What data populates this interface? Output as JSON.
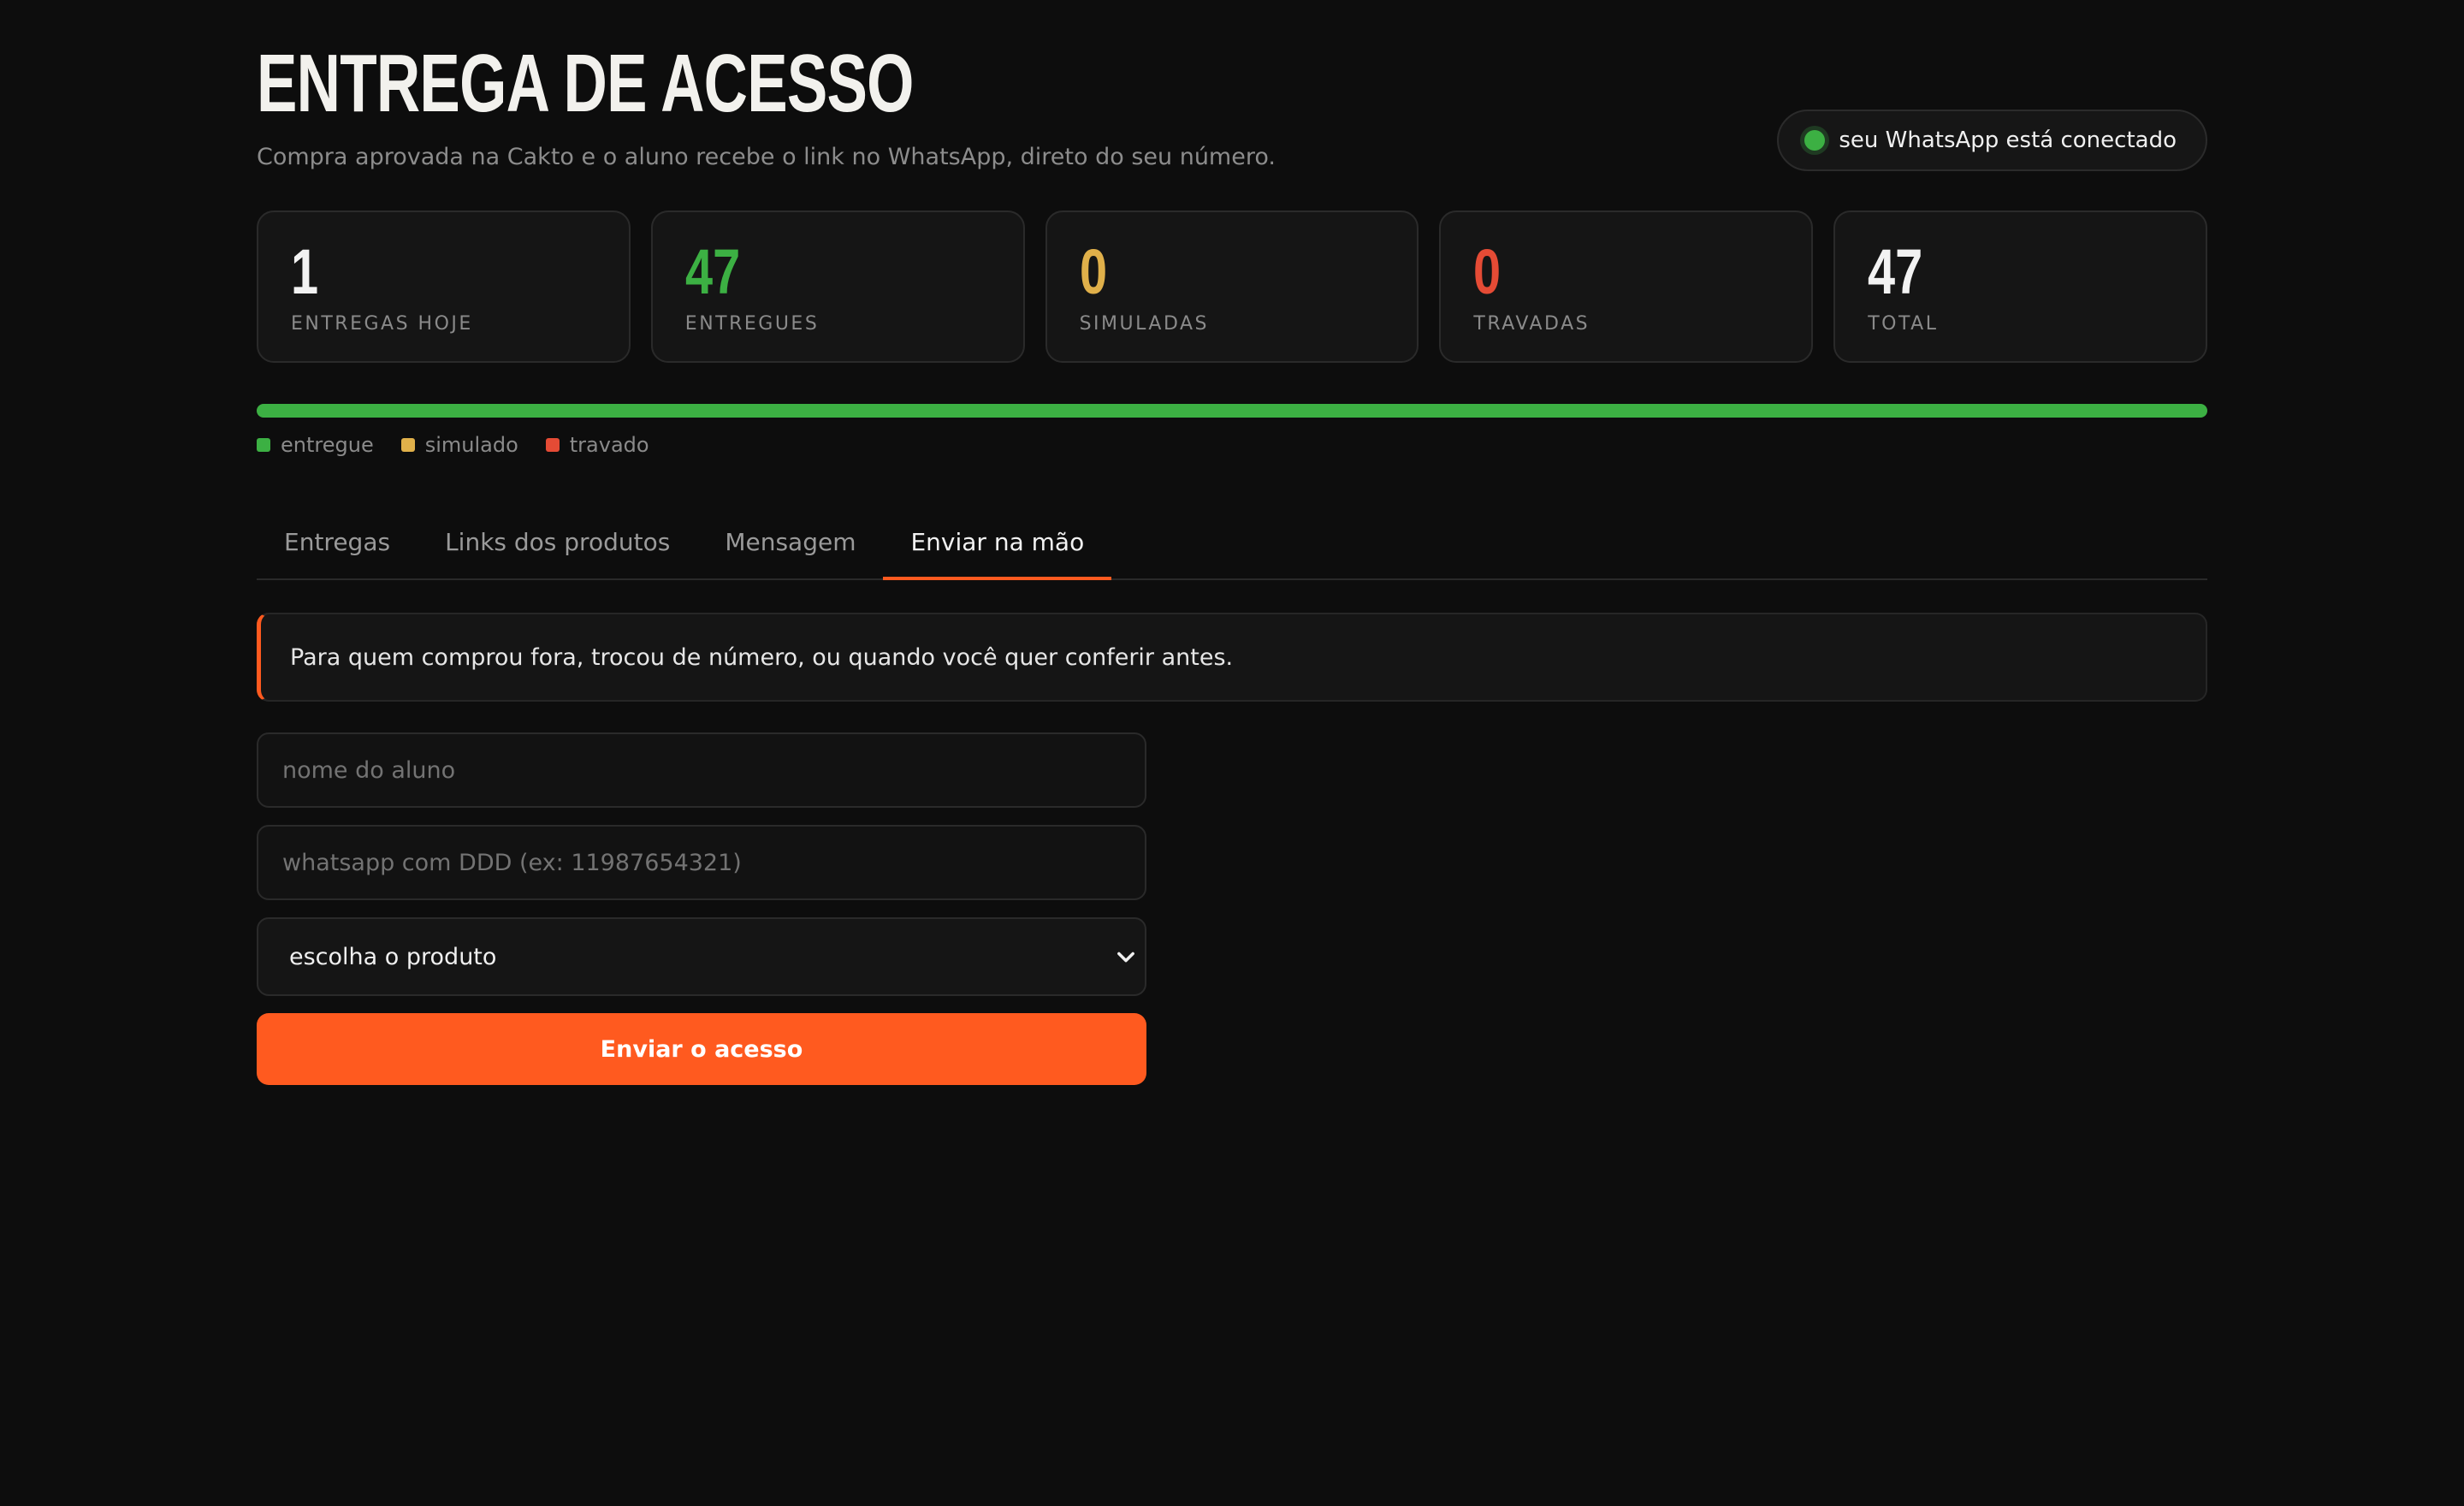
{
  "header": {
    "title": "ENTREGA DE ACESSO",
    "subtitle": "Compra aprovada na Cakto e o aluno recebe o link no WhatsApp, direto do seu número.",
    "status": {
      "text": "seu WhatsApp está conectado",
      "dot_color": "#3cb043"
    }
  },
  "stats": [
    {
      "value": "1",
      "label": "ENTREGAS HOJE",
      "color": "#f2f2f2"
    },
    {
      "value": "47",
      "label": "ENTREGUES",
      "color": "#3cb043"
    },
    {
      "value": "0",
      "label": "SIMULADAS",
      "color": "#e0b04a"
    },
    {
      "value": "0",
      "label": "TRAVADAS",
      "color": "#e54b35"
    },
    {
      "value": "47",
      "label": "TOTAL",
      "color": "#f2f2f2"
    }
  ],
  "progress": {
    "entregue_fraction": 1.0,
    "simulado_fraction": 0.0,
    "travado_fraction": 0.0
  },
  "legend": [
    {
      "label": "entregue",
      "color": "#3cb043"
    },
    {
      "label": "simulado",
      "color": "#e0b04a"
    },
    {
      "label": "travado",
      "color": "#e54b35"
    }
  ],
  "tabs": [
    {
      "label": "Entregas",
      "active": false
    },
    {
      "label": "Links dos produtos",
      "active": false
    },
    {
      "label": "Mensagem",
      "active": false
    },
    {
      "label": "Enviar na mão",
      "active": true
    }
  ],
  "notice": {
    "text": "Para quem comprou fora, trocou de número, ou quando você quer conferir antes."
  },
  "form": {
    "name_placeholder": "nome do aluno",
    "name_value": "",
    "phone_placeholder": "whatsapp com DDD (ex: 11987654321)",
    "phone_value": "",
    "product_select": {
      "selected": "escolha o produto",
      "options": [
        "escolha o produto"
      ]
    },
    "submit_label": "Enviar o acesso"
  },
  "colors": {
    "accent": "#ff5a1f",
    "background": "#0d0d0d",
    "success": "#3cb043",
    "warning": "#e0b04a",
    "danger": "#e54b35"
  }
}
